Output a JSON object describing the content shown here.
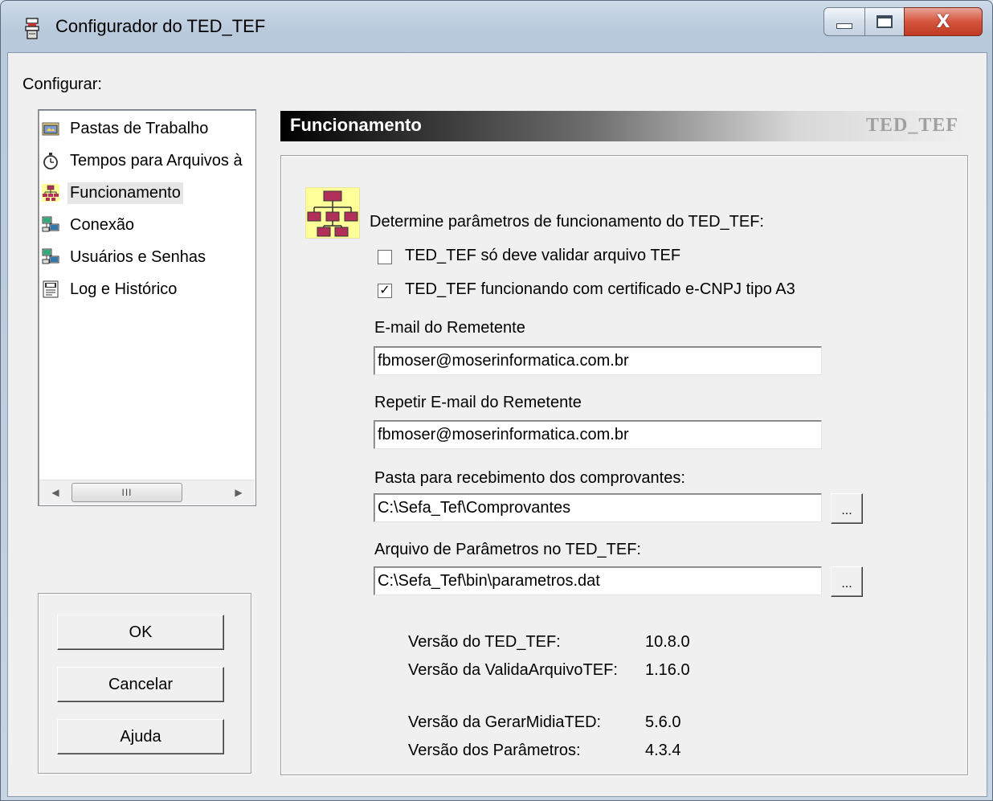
{
  "window": {
    "title": "Configurador do TED_TEF",
    "controls": {
      "minimize": "minimize-icon",
      "maximize": "maximize-icon",
      "close": "X"
    }
  },
  "left": {
    "label": "Configurar:",
    "items": [
      {
        "label": "Pastas de Trabalho",
        "icon": "folder-icon"
      },
      {
        "label": "Tempos para Arquivos à",
        "icon": "stopwatch-icon"
      },
      {
        "label": "Funcionamento",
        "icon": "org-chart-icon",
        "selected": true
      },
      {
        "label": "Conexão",
        "icon": "network-computers-icon"
      },
      {
        "label": "Usuários e Senhas",
        "icon": "users-computers-icon"
      },
      {
        "label": "Log e Histórico",
        "icon": "log-document-icon"
      }
    ],
    "scrollbar": {
      "thumb_grip": "III"
    }
  },
  "buttons": {
    "ok": "OK",
    "cancel": "Cancelar",
    "help": "Ajuda"
  },
  "panel": {
    "title": "Funcionamento",
    "brand": "TED_TEF",
    "intro": "Determine parâmetros de funcionamento do TED_TEF:",
    "check1": {
      "label": "TED_TEF só deve validar arquivo TEF",
      "checked": false
    },
    "check2": {
      "label": "TED_TEF funcionando com certificado e-CNPJ tipo A3",
      "checked": true,
      "mark": "✓"
    },
    "email_label": "E-mail do Remetente",
    "email_value": "fbmoser@moserinformatica.com.br",
    "email_repeat_label": "Repetir E-mail do Remetente",
    "email_repeat_value": "fbmoser@moserinformatica.com.br",
    "folder_label": "Pasta para recebimento dos comprovantes:",
    "folder_value": "C:\\Sefa_Tef\\Comprovantes",
    "params_label": "Arquivo de Parâmetros no TED_TEF:",
    "params_value": "C:\\Sefa_Tef\\bin\\parametros.dat",
    "browse_label": "...",
    "versions": [
      {
        "label": "Versão do TED_TEF:",
        "value": "10.8.0"
      },
      {
        "label": "Versão da ValidaArquivoTEF:",
        "value": "1.16.0"
      },
      {
        "label": "Versão da GerarMidiaTED:",
        "value": "5.6.0"
      },
      {
        "label": "Versão dos Parâmetros:",
        "value": "4.3.4"
      }
    ]
  }
}
